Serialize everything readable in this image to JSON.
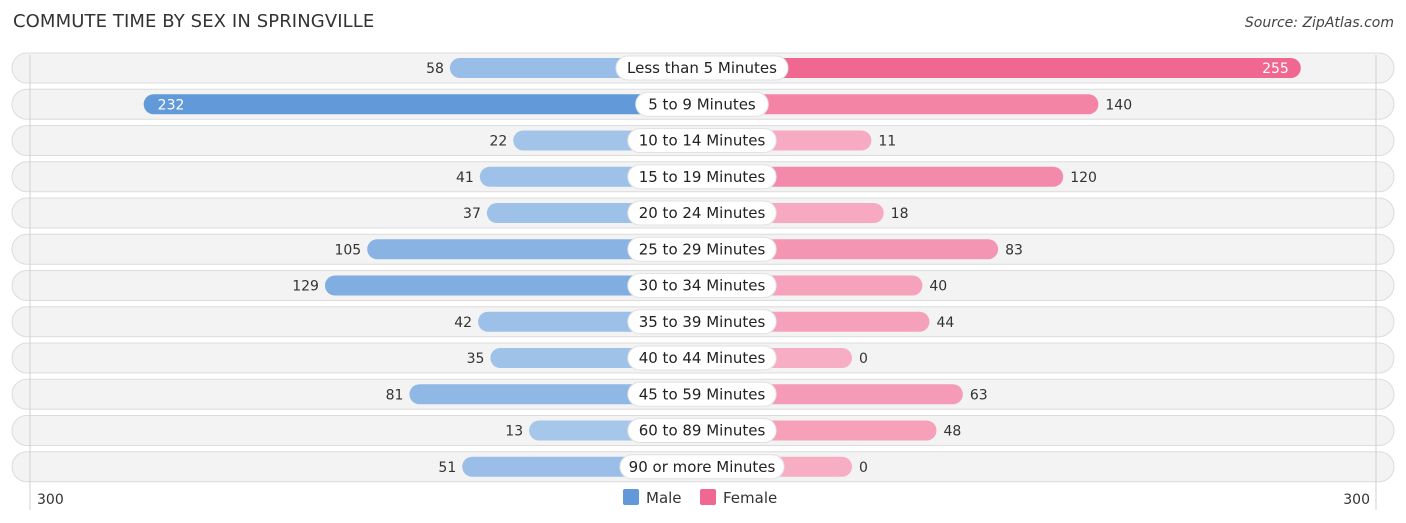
{
  "header": {
    "title": "COMMUTE TIME BY SEX IN SPRINGVILLE",
    "source": "Source: ZipAtlas.com"
  },
  "chart_data": {
    "type": "bar",
    "orientation": "horizontal-diverging",
    "title": "COMMUTE TIME BY SEX IN SPRINGVILLE",
    "categories": [
      "Less than 5 Minutes",
      "5 to 9 Minutes",
      "10 to 14 Minutes",
      "15 to 19 Minutes",
      "20 to 24 Minutes",
      "25 to 29 Minutes",
      "30 to 34 Minutes",
      "35 to 39 Minutes",
      "40 to 44 Minutes",
      "45 to 59 Minutes",
      "60 to 89 Minutes",
      "90 or more Minutes"
    ],
    "series": [
      {
        "name": "Male",
        "side": "left",
        "color": "#6199d9",
        "light_color": "#aac9eb",
        "values": [
          58,
          232,
          22,
          41,
          37,
          105,
          129,
          42,
          35,
          81,
          13,
          51
        ]
      },
      {
        "name": "Female",
        "side": "right",
        "color": "#f06892",
        "light_color": "#f7aec5",
        "values": [
          255,
          140,
          11,
          120,
          18,
          83,
          40,
          44,
          0,
          63,
          48,
          0
        ]
      }
    ],
    "axis": {
      "min_label": "300",
      "max_label": "300",
      "range": [
        0,
        300
      ]
    },
    "legend": {
      "position": "bottom-center",
      "items": [
        "Male",
        "Female"
      ]
    },
    "grid": false
  }
}
